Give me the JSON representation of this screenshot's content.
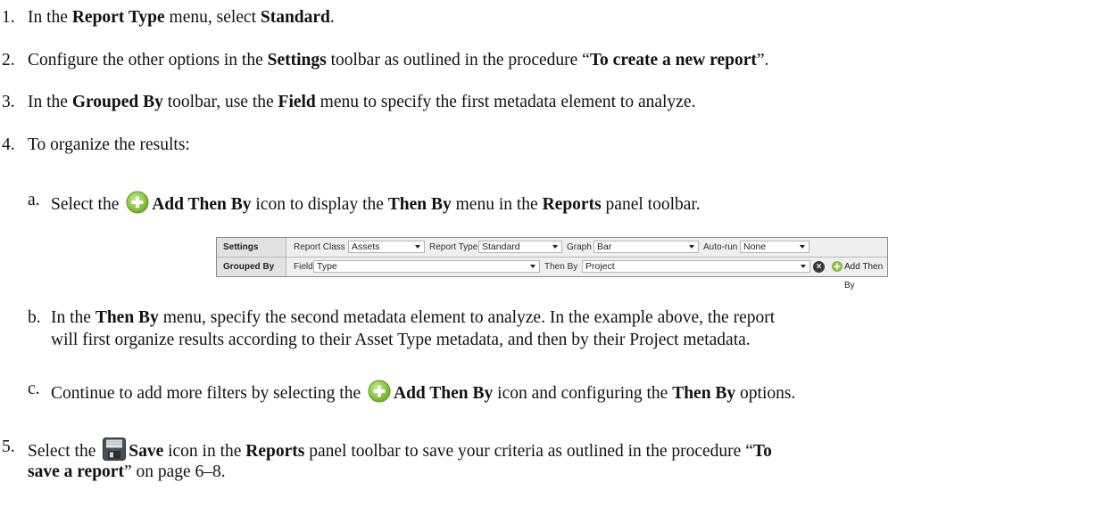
{
  "steps": [
    {
      "num": "1.",
      "segments": [
        {
          "t": "In the "
        },
        {
          "t": "Report Type",
          "b": true
        },
        {
          "t": " menu, select "
        },
        {
          "t": "Standard",
          "b": true
        },
        {
          "t": "."
        }
      ]
    },
    {
      "num": "2.",
      "segments": [
        {
          "t": "Configure the other options in the "
        },
        {
          "t": "Settings",
          "b": true
        },
        {
          "t": " toolbar as outlined in the procedure “"
        },
        {
          "t": "To create a new report",
          "b": true
        },
        {
          "t": "”."
        }
      ]
    },
    {
      "num": "3.",
      "segments": [
        {
          "t": "In the "
        },
        {
          "t": "Grouped By",
          "b": true
        },
        {
          "t": " toolbar, use the "
        },
        {
          "t": "Field",
          "b": true
        },
        {
          "t": " menu to specify the first metadata element to analyze."
        }
      ]
    },
    {
      "num": "4.",
      "segments": [
        {
          "t": "To organize the results:"
        }
      ]
    }
  ],
  "substeps": {
    "a": {
      "num": "a.",
      "before": "Select the ",
      "icon": "add-then-by-icon",
      "bold": "Add Then By",
      "middle": " icon to display the ",
      "bold2": "Then By",
      "middle2": " menu in the ",
      "bold3": "Reports",
      "after": " panel toolbar."
    },
    "b": {
      "num": "b.",
      "line1_a": "In the ",
      "line1_bold": "Then By",
      "line1_b": " menu, specify the second metadata element to analyze. In the example above, the report",
      "line2": "will first organize results according to their Asset Type metadata, and then by their Project metadata."
    },
    "c": {
      "num": "c.",
      "before": "Continue to add more filters by selecting the ",
      "icon": "add-then-by-icon",
      "bold": "Add Then By",
      "middle": " icon and configuring the ",
      "bold2": "Then By",
      "after": " options."
    }
  },
  "step5": {
    "num": "5.",
    "before": "Select the ",
    "icon": "save-icon",
    "bold": "Save",
    "middle": " icon in the ",
    "bold2": "Reports",
    "middle2": " panel toolbar to save your criteria as outlined in the procedure “",
    "bold3": "To",
    "line2_bold": "save a report",
    "line2_after": "” on page 6–8."
  },
  "toolbar": {
    "settings_label": "Settings",
    "report_class_label": "Report Class",
    "report_class_value": "Assets",
    "report_type_label": "Report Type",
    "report_type_value": "Standard",
    "graph_label": "Graph",
    "graph_value": "Bar",
    "autorun_label": "Auto-run",
    "autorun_value": "None",
    "grouped_by_label": "Grouped By",
    "field_label": "Field",
    "field_value": "Type",
    "then_by_label": "Then By",
    "then_by_value": "Project",
    "remove_icon": "close-circle-icon",
    "add_then_by_label": "Add Then By"
  },
  "colors": {
    "add_icon": "#8cc63f",
    "save_icon": "#4a4f56"
  }
}
